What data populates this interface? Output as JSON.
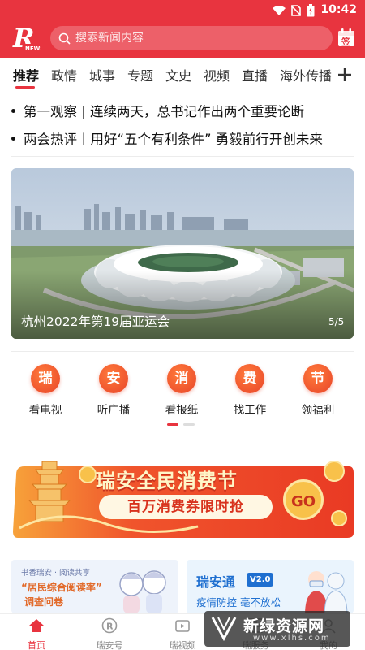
{
  "status_bar": {
    "time": "10:42"
  },
  "header": {
    "logo_text": "R",
    "logo_sub": "NEWS",
    "search_placeholder": "搜索新闻内容",
    "checkin_label": "签"
  },
  "tabs": [
    {
      "label": "推荐",
      "active": true
    },
    {
      "label": "政情"
    },
    {
      "label": "城事"
    },
    {
      "label": "专题"
    },
    {
      "label": "文史"
    },
    {
      "label": "视频"
    },
    {
      "label": "直播"
    },
    {
      "label": "海外传播"
    }
  ],
  "headlines": [
    "第一观察 | 连续两天，总书记作出两个重要论断",
    "两会热评丨用好“五个有利条件” 勇毅前行开创未来"
  ],
  "banner": {
    "caption": "杭州2022年第19届亚运会",
    "counter": "5/5"
  },
  "services": [
    {
      "char": "瑞",
      "label": "看电视"
    },
    {
      "char": "安",
      "label": "听广播"
    },
    {
      "char": "消",
      "label": "看报纸"
    },
    {
      "char": "费",
      "label": "找工作"
    },
    {
      "char": "节",
      "label": "领福利"
    }
  ],
  "promo": {
    "title": "瑞安全民消费节",
    "subtitle": "百万消费券限时抢",
    "go": "GO"
  },
  "cards": {
    "left": {
      "line1": "书香瑞安 · 阅读共享",
      "line2": "“居民综合阅读率”",
      "line3": "调查问卷"
    },
    "right": {
      "title": "瑞安通",
      "version": "V2.0",
      "subtitle": "疫情防控  毫不放松"
    }
  },
  "bottom_nav": [
    {
      "label": "首页",
      "active": true
    },
    {
      "label": "瑞安号"
    },
    {
      "label": "瑞视频"
    },
    {
      "label": "瑞服务"
    },
    {
      "label": "我的"
    }
  ],
  "watermark": {
    "text": "新绿资源网",
    "url": "www.xlhs.com"
  },
  "colors": {
    "brand": "#e8343f",
    "service_orange": "#e8452a"
  }
}
